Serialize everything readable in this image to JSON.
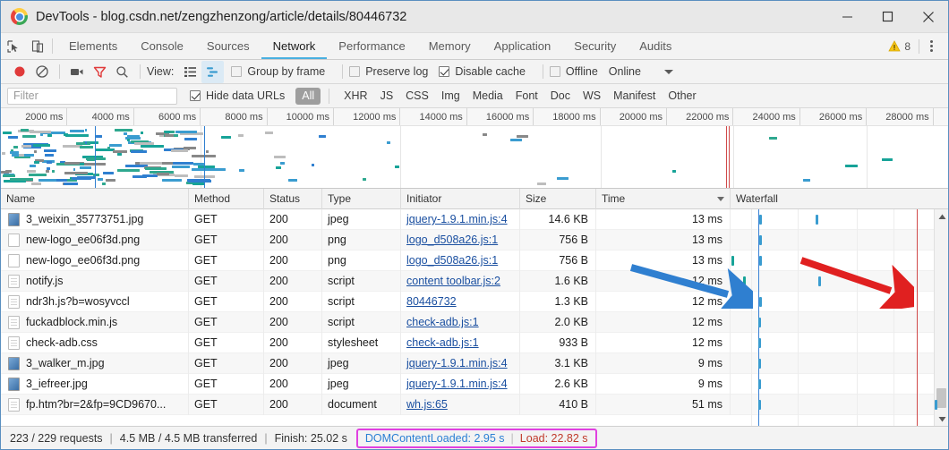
{
  "window": {
    "title": "DevTools - blog.csdn.net/zengzhenzong/article/details/80446732",
    "logo_icon": "chrome-logo-icon",
    "minimize_label": "minimize-icon",
    "maximize_label": "maximize-icon",
    "close_label": "close-icon"
  },
  "tabstrip": {
    "inspect_icon": "inspect-element-icon",
    "device_icon": "toggle-device-toolbar-icon",
    "tabs": [
      {
        "label": "Elements",
        "active": false
      },
      {
        "label": "Console",
        "active": false
      },
      {
        "label": "Sources",
        "active": false
      },
      {
        "label": "Network",
        "active": true
      },
      {
        "label": "Performance",
        "active": false
      },
      {
        "label": "Memory",
        "active": false
      },
      {
        "label": "Application",
        "active": false
      },
      {
        "label": "Security",
        "active": false
      },
      {
        "label": "Audits",
        "active": false
      }
    ],
    "warning_icon": "warning-triangle-icon",
    "warning_count": "8",
    "menu_icon": "kebab-menu-icon"
  },
  "toolbar": {
    "record_icon": "record-button-icon",
    "clear_icon": "clear-icon",
    "camera_icon": "capture-screenshots-icon",
    "filter_icon": "filter-funnel-icon",
    "search_icon": "search-icon",
    "view_label": "View:",
    "list_view_icon": "list-view-icon",
    "waterfall_view_icon": "waterfall-view-icon",
    "group_by_frame_label": "Group by frame",
    "group_by_frame_checked": false,
    "preserve_log_label": "Preserve log",
    "preserve_log_checked": false,
    "disable_cache_label": "Disable cache",
    "disable_cache_checked": true,
    "offline_label": "Offline",
    "offline_checked": false,
    "throttling_value": "Online",
    "throttling_caret_icon": "chevron-down-icon"
  },
  "filterbar": {
    "filter_placeholder": "Filter",
    "filter_value": "",
    "hide_data_urls_label": "Hide data URLs",
    "hide_data_urls_checked": true,
    "types": [
      {
        "label": "All",
        "active": true
      },
      {
        "label": "XHR",
        "active": false
      },
      {
        "label": "JS",
        "active": false
      },
      {
        "label": "CSS",
        "active": false
      },
      {
        "label": "Img",
        "active": false
      },
      {
        "label": "Media",
        "active": false
      },
      {
        "label": "Font",
        "active": false
      },
      {
        "label": "Doc",
        "active": false
      },
      {
        "label": "WS",
        "active": false
      },
      {
        "label": "Manifest",
        "active": false
      },
      {
        "label": "Other",
        "active": false
      }
    ]
  },
  "overview": {
    "ruler_ticks": [
      "2000 ms",
      "4000 ms",
      "6000 ms",
      "8000 ms",
      "10000 ms",
      "12000 ms",
      "14000 ms",
      "16000 ms",
      "18000 ms",
      "20000 ms",
      "22000 ms",
      "24000 ms",
      "26000 ms",
      "28000 ms"
    ]
  },
  "table": {
    "columns": [
      {
        "label": "Name"
      },
      {
        "label": "Method"
      },
      {
        "label": "Status"
      },
      {
        "label": "Type"
      },
      {
        "label": "Initiator"
      },
      {
        "label": "Size"
      },
      {
        "label": "Time",
        "sorted": true,
        "sort_icon": "sort-descending-icon"
      },
      {
        "label": "Waterfall"
      }
    ],
    "rows": [
      {
        "icon": "image-file-icon",
        "name": "3_weixin_35773751.jpg",
        "method": "GET",
        "status": "200",
        "type": "jpeg",
        "initiator": "jquery-1.9.1.min.js:4",
        "size": "14.6 KB",
        "time": "13 ms"
      },
      {
        "icon": "generic-file-icon",
        "name": "new-logo_ee06f3d.png",
        "method": "GET",
        "status": "200",
        "type": "png",
        "initiator": "logo_d508a26.js:1",
        "size": "756 B",
        "time": "13 ms"
      },
      {
        "icon": "generic-file-icon",
        "name": "new-logo_ee06f3d.png",
        "method": "GET",
        "status": "200",
        "type": "png",
        "initiator": "logo_d508a26.js:1",
        "size": "756 B",
        "time": "13 ms"
      },
      {
        "icon": "script-file-icon",
        "name": "notify.js",
        "method": "GET",
        "status": "200",
        "type": "script",
        "initiator": "content toolbar.js:2",
        "size": "1.6 KB",
        "time": "12 ms"
      },
      {
        "icon": "script-file-icon",
        "name": "ndr3h.js?b=wosyvccl",
        "method": "GET",
        "status": "200",
        "type": "script",
        "initiator": "80446732",
        "size": "1.3 KB",
        "time": "12 ms"
      },
      {
        "icon": "script-file-icon",
        "name": "fuckadblock.min.js",
        "method": "GET",
        "status": "200",
        "type": "script",
        "initiator": "check-adb.js:1",
        "size": "2.0 KB",
        "time": "12 ms"
      },
      {
        "icon": "stylesheet-file-icon",
        "name": "check-adb.css",
        "method": "GET",
        "status": "200",
        "type": "stylesheet",
        "initiator": "check-adb.js:1",
        "size": "933 B",
        "time": "12 ms"
      },
      {
        "icon": "image-file-icon",
        "name": "3_walker_m.jpg",
        "method": "GET",
        "status": "200",
        "type": "jpeg",
        "initiator": "jquery-1.9.1.min.js:4",
        "size": "3.1 KB",
        "time": "9 ms"
      },
      {
        "icon": "image-file-icon",
        "name": "3_iefreer.jpg",
        "method": "GET",
        "status": "200",
        "type": "jpeg",
        "initiator": "jquery-1.9.1.min.js:4",
        "size": "2.6 KB",
        "time": "9 ms"
      },
      {
        "icon": "document-file-icon",
        "name": "fp.htm?br=2&fp=9CD9670...",
        "method": "GET",
        "status": "200",
        "type": "document",
        "initiator": "wh.js:65",
        "size": "410 B",
        "time": "51 ms"
      }
    ],
    "scrollbar_up_icon": "scroll-up-arrow-icon",
    "scrollbar_down_icon": "scroll-down-arrow-icon"
  },
  "statusbar": {
    "requests": "223 / 229 requests",
    "transferred": "4.5 MB / 4.5 MB transferred",
    "finish": "Finish: 25.02 s",
    "dom_content_loaded": "DOMContentLoaded: 2.95 s",
    "load": "Load: 22.82 s",
    "separator": "|"
  },
  "annotations": {
    "blue_arrow": "blue-arrow-annotation",
    "red_arrow": "red-arrow-annotation",
    "highlight_box": "magenta-highlight-box"
  },
  "colors": {
    "accent": "#4ab0e0",
    "dcl_blue": "#2a7fd4",
    "load_red": "#c0392b",
    "highlight_magenta": "#e040e0",
    "record_red": "#e03a3a"
  }
}
